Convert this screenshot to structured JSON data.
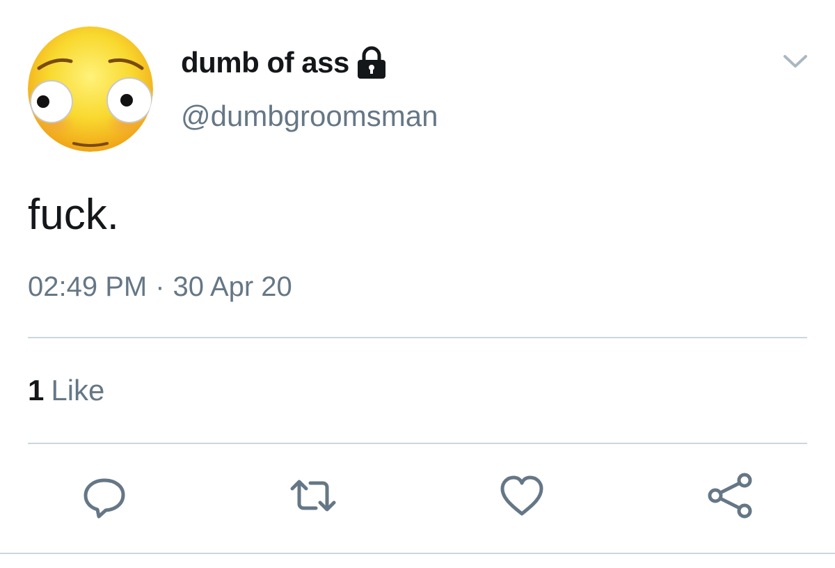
{
  "tweet": {
    "display_name": "dumb of ass",
    "handle": "@dumbgroomsman",
    "text": "fuck.",
    "time": "02:49 PM",
    "separator": "·",
    "date": "30 Apr 20",
    "like_count": "1",
    "like_label": "Like",
    "protected": true
  },
  "icons": {
    "lock": "lock-icon",
    "caret": "chevron-down-icon",
    "reply": "reply-icon",
    "retweet": "retweet-icon",
    "like": "heart-icon",
    "share": "share-icon"
  },
  "colors": {
    "text_primary": "#14171a",
    "text_secondary": "#657786",
    "divider": "#ccd6dd",
    "avatar_face": "#f7d12c"
  }
}
